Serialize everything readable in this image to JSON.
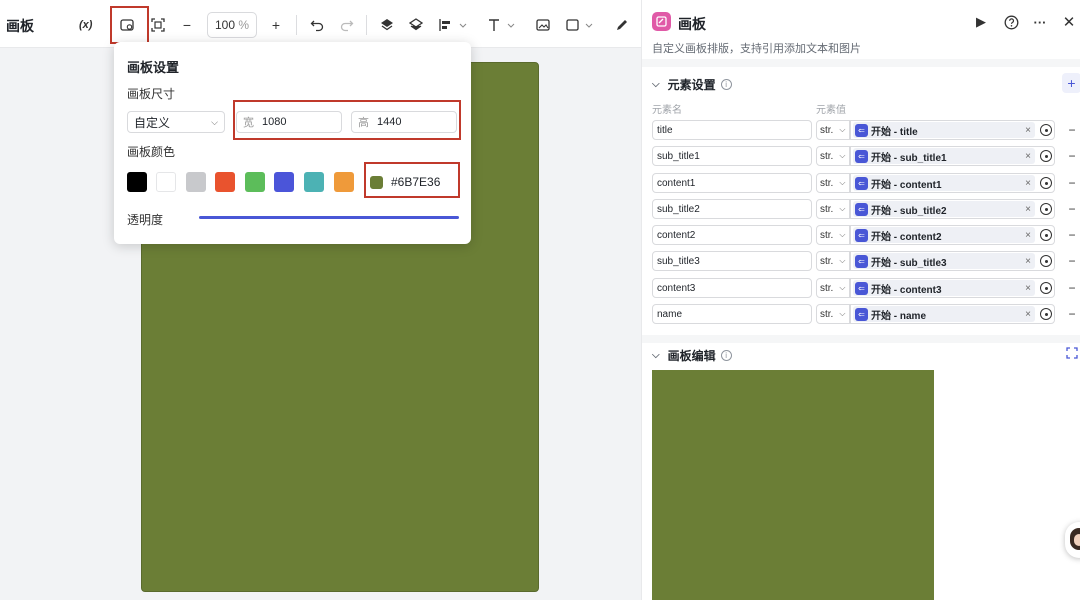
{
  "toolbar": {
    "title": "画板",
    "variable_label": "(x)",
    "zoom_value": "100",
    "zoom_unit": "%"
  },
  "popup": {
    "title": "画板设置",
    "size_label": "画板尺寸",
    "preset_value": "自定义",
    "width_key": "宽",
    "width_value": "1080",
    "height_key": "高",
    "height_value": "1440",
    "color_label": "画板颜色",
    "swatches": [
      "#000000",
      "#ffffff",
      "#c8c9cc",
      "#e9532e",
      "#5cbd5a",
      "#4b55d9",
      "#4cb2b4",
      "#ef9a3a"
    ],
    "selected_color": "#6B7E36",
    "opacity_label": "透明度"
  },
  "canvas": {
    "color": "#6b7e36"
  },
  "panel": {
    "title": "画板",
    "subtitle": "自定义画板排版，支持引用添加文本和图片",
    "elements_title": "元素设置",
    "col_name": "元素名",
    "col_value": "元素值",
    "rows": [
      {
        "name": "title",
        "type": "str.",
        "ref": "开始 - title"
      },
      {
        "name": "sub_title1",
        "type": "str.",
        "ref": "开始 - sub_title1"
      },
      {
        "name": "content1",
        "type": "str.",
        "ref": "开始 - content1"
      },
      {
        "name": "sub_title2",
        "type": "str.",
        "ref": "开始 - sub_title2"
      },
      {
        "name": "content2",
        "type": "str.",
        "ref": "开始 - content2"
      },
      {
        "name": "sub_title3",
        "type": "str.",
        "ref": "开始 - sub_title3"
      },
      {
        "name": "content3",
        "type": "str.",
        "ref": "开始 - content3"
      },
      {
        "name": "name",
        "type": "str.",
        "ref": "开始 - name"
      }
    ],
    "editor_title": "画板编辑"
  },
  "colors": {
    "accent": "#4957d6",
    "highlight": "#c0392b"
  }
}
